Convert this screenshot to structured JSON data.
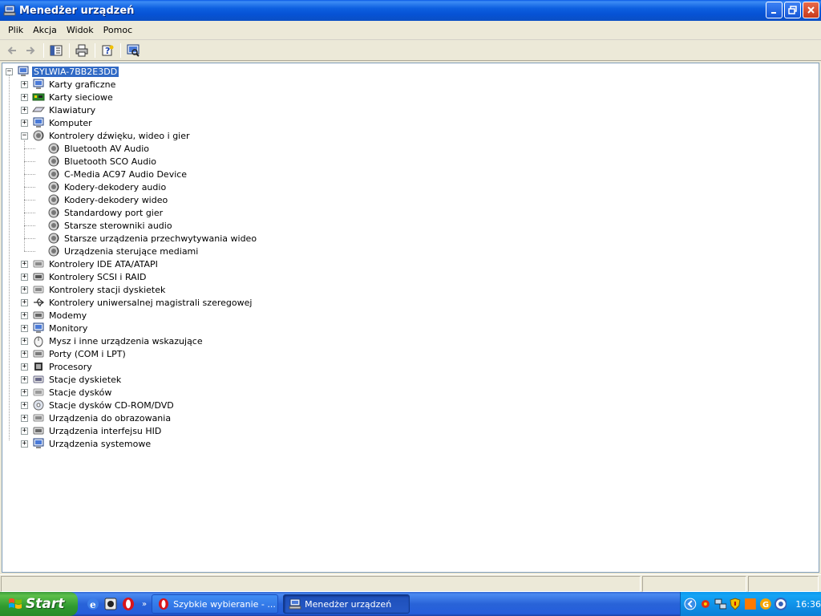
{
  "window": {
    "title": "Menedżer urządzeń"
  },
  "menu": [
    "Plik",
    "Akcja",
    "Widok",
    "Pomoc"
  ],
  "tree": {
    "root": "SYLWIA-7BB2E3DD",
    "categories": [
      {
        "label": "Karty graficzne",
        "icon": "display-adapter-icon",
        "expanded": false
      },
      {
        "label": "Karty sieciowe",
        "icon": "network-adapter-icon",
        "expanded": false
      },
      {
        "label": "Klawiatury",
        "icon": "keyboard-icon",
        "expanded": false
      },
      {
        "label": "Komputer",
        "icon": "computer-icon",
        "expanded": false
      },
      {
        "label": "Kontrolery dźwięku, wideo i gier",
        "icon": "sound-icon",
        "expanded": true,
        "children": [
          "Bluetooth AV Audio",
          "Bluetooth SCO Audio",
          "C-Media AC97 Audio Device",
          "Kodery-dekodery audio",
          "Kodery-dekodery wideo",
          "Standardowy port gier",
          "Starsze sterowniki audio",
          "Starsze urządzenia przechwytywania wideo",
          "Urządzenia sterujące mediami"
        ]
      },
      {
        "label": "Kontrolery IDE ATA/ATAPI",
        "icon": "ide-controller-icon",
        "expanded": false
      },
      {
        "label": "Kontrolery SCSI i RAID",
        "icon": "scsi-controller-icon",
        "expanded": false
      },
      {
        "label": "Kontrolery stacji dyskietek",
        "icon": "floppy-controller-icon",
        "expanded": false
      },
      {
        "label": "Kontrolery uniwersalnej magistrali szeregowej",
        "icon": "usb-icon",
        "expanded": false
      },
      {
        "label": "Modemy",
        "icon": "modem-icon",
        "expanded": false
      },
      {
        "label": "Monitory",
        "icon": "monitor-icon",
        "expanded": false
      },
      {
        "label": "Mysz i inne urządzenia wskazujące",
        "icon": "mouse-icon",
        "expanded": false
      },
      {
        "label": "Porty (COM i LPT)",
        "icon": "port-icon",
        "expanded": false
      },
      {
        "label": "Procesory",
        "icon": "processor-icon",
        "expanded": false
      },
      {
        "label": "Stacje dyskietek",
        "icon": "floppy-drive-icon",
        "expanded": false
      },
      {
        "label": "Stacje dysków",
        "icon": "disk-drive-icon",
        "expanded": false
      },
      {
        "label": "Stacje dysków CD-ROM/DVD",
        "icon": "cdrom-icon",
        "expanded": false
      },
      {
        "label": "Urządzenia do obrazowania",
        "icon": "imaging-icon",
        "expanded": false
      },
      {
        "label": "Urządzenia interfejsu HID",
        "icon": "hid-icon",
        "expanded": false
      },
      {
        "label": "Urządzenia systemowe",
        "icon": "system-device-icon",
        "expanded": false
      }
    ]
  },
  "taskbar": {
    "start": "Start",
    "tasks": [
      {
        "label": "Szybkie wybieranie - ...",
        "active": false
      },
      {
        "label": "Menedżer urządzeń",
        "active": true
      }
    ],
    "clock": "16:36"
  },
  "colors": {
    "selection": "#316ac5",
    "titlebar": "#0a58e6",
    "taskbar": "#245edb",
    "start": "#3c9c3c"
  }
}
